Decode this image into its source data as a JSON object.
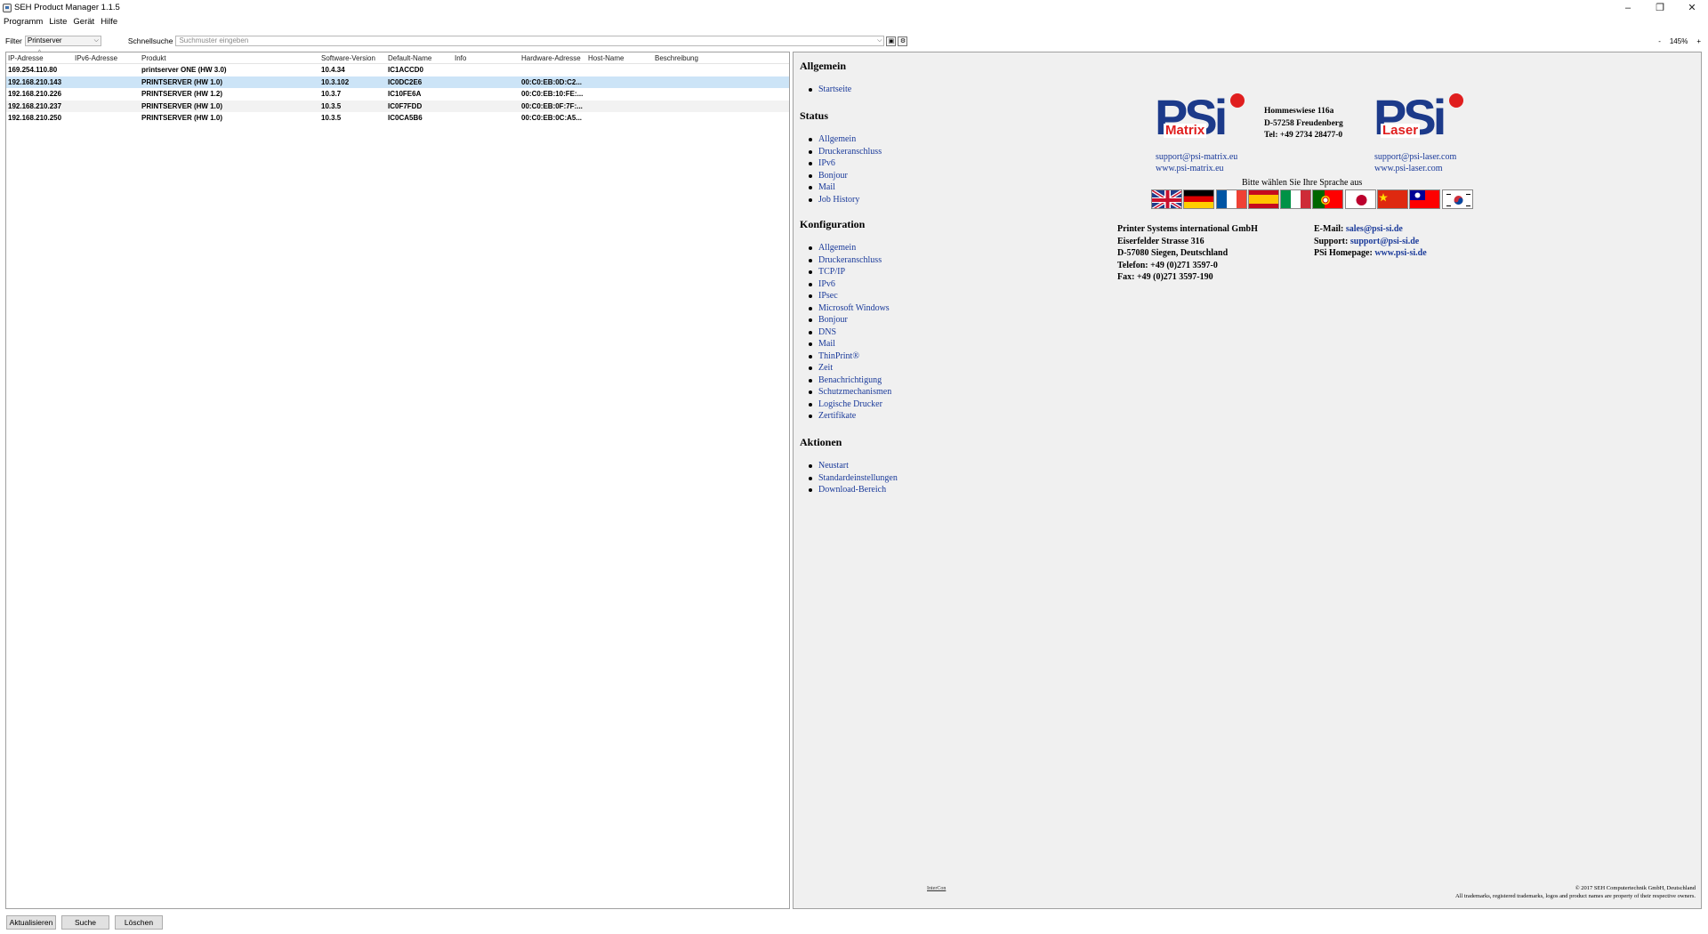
{
  "window": {
    "title": "SEH Product Manager 1.1.5",
    "controls": [
      "–",
      "❐",
      "✕"
    ]
  },
  "menu": [
    "Programm",
    "Liste",
    "Gerät",
    "Hilfe"
  ],
  "toolbar": {
    "filter_label": "Filter",
    "filter_value": "Printserver",
    "quick_label": "Schnellsuche",
    "quick_placeholder": "Suchmuster eingeben",
    "zoom_minus": "-",
    "zoom_value": "145%",
    "zoom_plus": "+"
  },
  "grid": {
    "columns": [
      "IP-Adresse",
      "IPv6-Adresse",
      "Produkt",
      "Software-Version",
      "Default-Name",
      "Info",
      "Hardware-Adresse",
      "Host-Name",
      "Beschreibung"
    ],
    "rows": [
      [
        "169.254.110.80",
        "",
        "printserver ONE (HW 3.0)",
        "10.4.34",
        "IC1ACCD0",
        "",
        "",
        "",
        ""
      ],
      [
        "192.168.210.143",
        "",
        "PRINTSERVER (HW 1.0)",
        "10.3.102",
        "IC0DC2E6",
        "",
        "00:C0:EB:0D:C2...",
        "",
        ""
      ],
      [
        "192.168.210.226",
        "",
        "PRINTSERVER (HW 1.2)",
        "10.3.7",
        "IC10FE6A",
        "",
        "00:C0:EB:10:FE:...",
        "",
        ""
      ],
      [
        "192.168.210.237",
        "",
        "PRINTSERVER (HW 1.0)",
        "10.3.5",
        "IC0F7FDD",
        "",
        "00:C0:EB:0F:7F:...",
        "",
        ""
      ],
      [
        "192.168.210.250",
        "",
        "PRINTSERVER (HW 1.0)",
        "10.3.5",
        "IC0CA5B6",
        "",
        "00:C0:EB:0C:A5...",
        "",
        ""
      ]
    ],
    "selected_row": 1
  },
  "web": {
    "allgemein": {
      "title": "Allgemein",
      "items": [
        "Startseite"
      ]
    },
    "status": {
      "title": "Status",
      "items": [
        "Allgemein",
        "Druckeranschluss",
        "IPv6",
        "Bonjour",
        "Mail",
        "Job History"
      ]
    },
    "konfiguration": {
      "title": "Konfiguration",
      "items": [
        "Allgemein",
        "Druckeranschluss",
        "TCP/IP",
        "IPv6",
        "IPsec",
        "Microsoft Windows",
        "Bonjour",
        "DNS",
        "Mail",
        "ThinPrint®",
        "Zeit",
        "Benachrichtigung",
        "Schutzmechanismen",
        "Logische Drucker",
        "Zertifikate"
      ]
    },
    "aktionen": {
      "title": "Aktionen",
      "items": [
        "Neustart",
        "Standardeinstellungen",
        "Download-Bereich"
      ]
    },
    "logo_matrix": {
      "mark": "PSi",
      "sub": "Matrix",
      "email": "support@psi-matrix.eu",
      "web": "www.psi-matrix.eu"
    },
    "logo_laser": {
      "mark": "PSi",
      "sub": "Laser",
      "email": "support@psi-laser.com",
      "web": "www.psi-laser.com"
    },
    "address": [
      "Hommeswiese 116a",
      "D-57258 Freudenberg",
      "Tel: +49 2734 28477-0"
    ],
    "lang_prompt": "Bitte wählen Sie Ihre Sprache aus",
    "flags": [
      "flag-uk",
      "flag-de",
      "flag-fr",
      "flag-es",
      "flag-it",
      "flag-pt",
      "flag-jp",
      "flag-cn",
      "flag-tw",
      "flag-kr"
    ],
    "company": [
      "Printer Systems international GmbH",
      "Eiserfelder Strasse 316",
      "D-57080 Siegen, Deutschland",
      "Telefon: +49 (0)271 3597-0",
      "Fax: +49 (0)271 3597-190"
    ],
    "contact": {
      "email_label": "E-Mail:",
      "email": "sales@psi-si.de",
      "support_label": "Support:",
      "support": "support@psi-si.de",
      "home_label": "PSi Homepage:",
      "home": "www.psi-si.de"
    },
    "footer_logo": "InterCon",
    "copyright": [
      "© 2017 SEH Computertechnik GmbH, Deutschland",
      "All trademarks, registered trademarks, logos and product names are property of their respective owners."
    ]
  },
  "buttons": [
    "Aktualisieren",
    "Suche",
    "Löschen"
  ]
}
